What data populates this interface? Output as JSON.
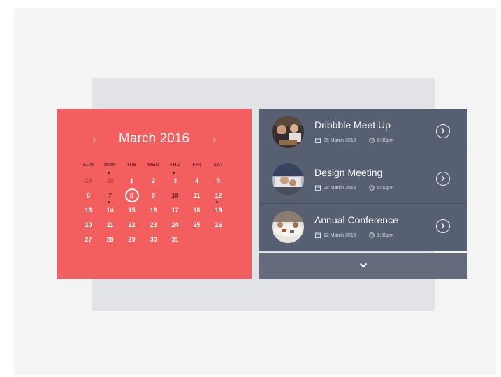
{
  "calendar": {
    "month_title": "March 2016",
    "prev_icon": "chevron-left-icon",
    "next_icon": "chevron-right-icon",
    "weekdays": [
      "SUN",
      "MON",
      "TUE",
      "WED",
      "THU",
      "FRI",
      "SAT"
    ],
    "weeks": [
      [
        {
          "d": "28",
          "muted": true
        },
        {
          "d": "29",
          "muted": true,
          "dot": true
        },
        {
          "d": "1"
        },
        {
          "d": "2"
        },
        {
          "d": "3",
          "dot": true
        },
        {
          "d": "4"
        },
        {
          "d": "5"
        }
      ],
      [
        {
          "d": "6"
        },
        {
          "d": "7",
          "dark": true
        },
        {
          "d": "8",
          "today": true
        },
        {
          "d": "9"
        },
        {
          "d": "10",
          "dark": true
        },
        {
          "d": "11"
        },
        {
          "d": "12"
        }
      ],
      [
        {
          "d": "13"
        },
        {
          "d": "14",
          "dot": true
        },
        {
          "d": "15"
        },
        {
          "d": "16"
        },
        {
          "d": "17"
        },
        {
          "d": "18"
        },
        {
          "d": "19",
          "dot": true
        }
      ],
      [
        {
          "d": "20"
        },
        {
          "d": "21"
        },
        {
          "d": "22"
        },
        {
          "d": "23"
        },
        {
          "d": "24"
        },
        {
          "d": "25"
        },
        {
          "d": "26"
        }
      ],
      [
        {
          "d": "27"
        },
        {
          "d": "28"
        },
        {
          "d": "29"
        },
        {
          "d": "30"
        },
        {
          "d": "31"
        }
      ]
    ],
    "colors": {
      "background": "#f35f5f",
      "text": "#ffffff",
      "muted": "#b94444"
    }
  },
  "events": [
    {
      "title": "Dribbble Meet Up",
      "date": "05 March 2016",
      "time": "6:00pm",
      "thumb": "people-at-table-photo"
    },
    {
      "title": "Design Meeting",
      "date": "08 March 2016",
      "time": "5:00pm",
      "thumb": "hands-on-laptop-photo"
    },
    {
      "title": "Annual Conference",
      "date": "12 March 2016",
      "time": "1:00pm",
      "thumb": "conference-table-photo"
    }
  ],
  "more_icon": "chevron-down-icon",
  "colors": {
    "events_bg": "#575f72",
    "more_bg": "#636b7d"
  }
}
